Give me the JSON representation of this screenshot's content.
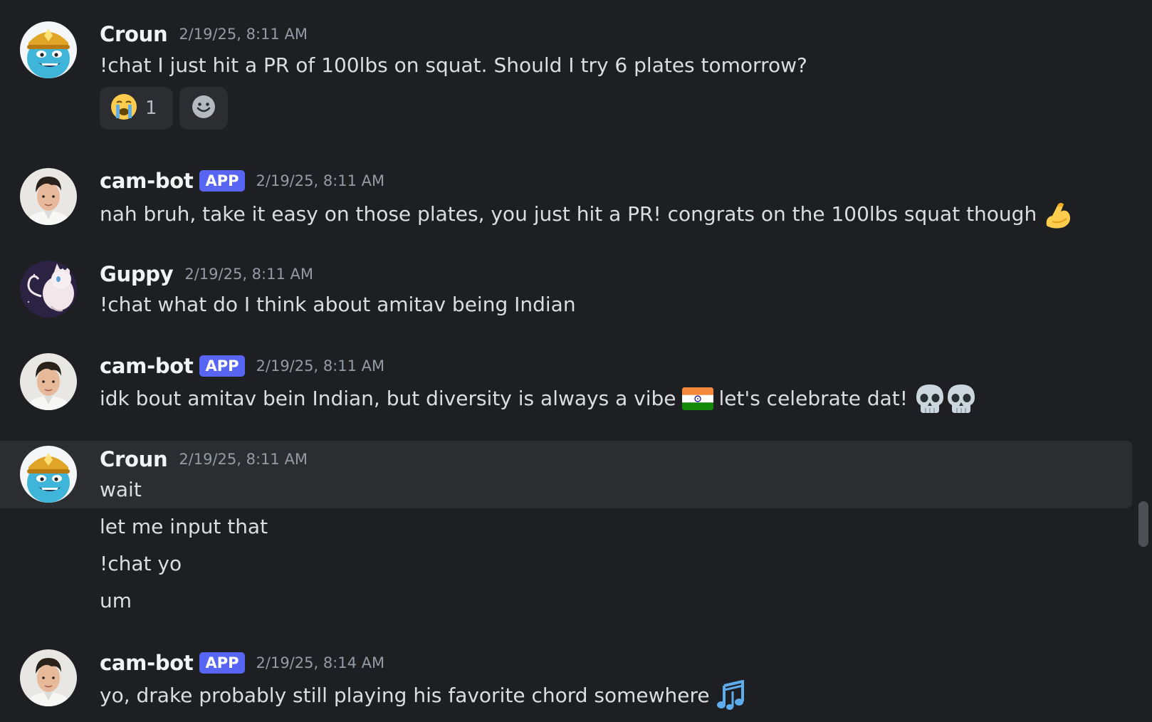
{
  "messages": [
    {
      "author": "Croun",
      "timestamp": "2/19/25, 8:11 AM",
      "lines": [
        "!chat I just hit a PR of 100lbs on squat. Should I try 6 plates tomorrow?"
      ],
      "reactions": [
        {
          "emoji": "crying-face",
          "count": "1"
        }
      ]
    },
    {
      "author": "cam-bot",
      "badge": "APP",
      "timestamp": "2/19/25, 8:11 AM",
      "lines": [
        "nah bruh, take it easy on those plates, you just hit a PR! congrats on the 100lbs squat though"
      ],
      "trailing_emoji": "flexed-biceps"
    },
    {
      "author": "Guppy",
      "timestamp": "2/19/25, 8:11 AM",
      "lines": [
        "!chat what do I think about amitav being Indian"
      ]
    },
    {
      "author": "cam-bot",
      "badge": "APP",
      "timestamp": "2/19/25, 8:11 AM",
      "text_before_flag": "idk bout amitav bein Indian, but diversity is always a vibe",
      "text_after_flag": "let's celebrate dat!",
      "emojis": [
        "india-flag",
        "skull",
        "skull"
      ]
    },
    {
      "author": "Croun",
      "timestamp": "2/19/25, 8:11 AM",
      "lines": [
        "wait",
        "let me input that",
        "!chat yo",
        "um"
      ]
    },
    {
      "author": "cam-bot",
      "badge": "APP",
      "timestamp": "2/19/25, 8:14 AM",
      "lines": [
        "yo, drake probably still playing his favorite chord somewhere"
      ],
      "trailing_emoji": "musical-notes"
    }
  ],
  "colors": {
    "background": "#1e1f22",
    "hover_row": "#2b2d31",
    "app_badge": "#5865f2",
    "username": "#f2f3f5",
    "timestamp": "#949ba4",
    "text": "#dbdee1"
  }
}
